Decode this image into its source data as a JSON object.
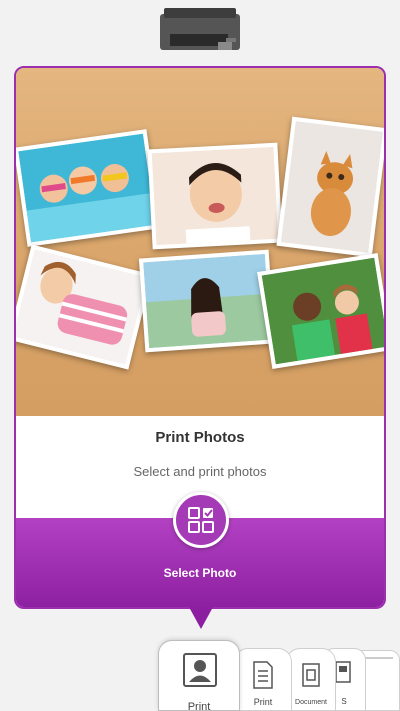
{
  "card": {
    "title": "Print Photos",
    "subtitle": "Select and print photos",
    "action_label": "Select Photo"
  },
  "tabs": [
    {
      "label": "Print",
      "icon": "photo-icon"
    },
    {
      "label": "Print",
      "icon": "document-icon"
    },
    {
      "label": "Document",
      "icon": "scan-doc-icon"
    },
    {
      "label": "S",
      "icon": "copy-icon"
    }
  ],
  "colors": {
    "accent": "#9b2fae",
    "band_top": "#b342c3",
    "band_bottom": "#8c1fa0"
  }
}
